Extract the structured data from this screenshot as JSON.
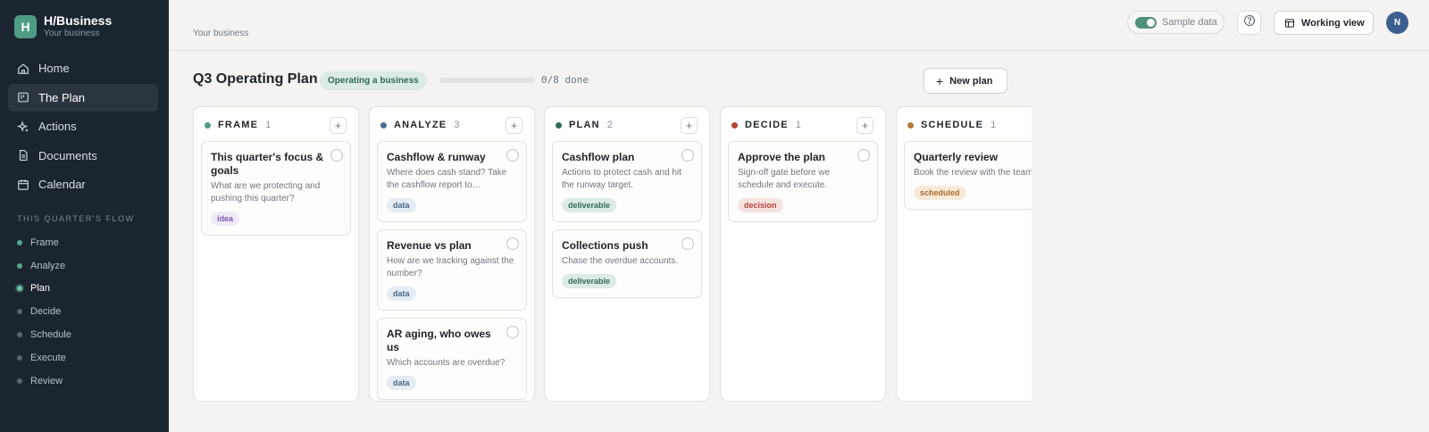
{
  "app": {
    "logo_letter": "H",
    "name": "H/Business",
    "subtitle": "Your business"
  },
  "nav": [
    {
      "label": "Home",
      "icon": "home-icon"
    },
    {
      "label": "The Plan",
      "icon": "board-icon",
      "active": true
    },
    {
      "label": "Actions",
      "icon": "sparkle-icon"
    },
    {
      "label": "Documents",
      "icon": "document-icon"
    },
    {
      "label": "Calendar",
      "icon": "calendar-icon"
    }
  ],
  "flow": {
    "title": "THIS QUARTER'S FLOW",
    "items": [
      {
        "label": "Frame",
        "state": "done"
      },
      {
        "label": "Analyze",
        "state": "done"
      },
      {
        "label": "Plan",
        "state": "current"
      },
      {
        "label": "Decide",
        "state": "todo"
      },
      {
        "label": "Schedule",
        "state": "todo"
      },
      {
        "label": "Execute",
        "state": "todo"
      },
      {
        "label": "Review",
        "state": "todo"
      }
    ]
  },
  "topbar": {
    "breadcrumb": "Your business",
    "sample_data_label": "Sample data",
    "sample_data_on": true,
    "working_view_label": "Working view",
    "avatar_initial": "N"
  },
  "plan": {
    "title": "Q3 Operating Plan",
    "mode_badge": "Operating a business",
    "progress_text": "0/8 done",
    "progress_fraction": 0,
    "new_plan_label": "New plan"
  },
  "columns": [
    {
      "name": "FRAME",
      "count": "1",
      "color": "#4f9c86",
      "cards": [
        {
          "title": "This quarter's focus & goals",
          "desc": "What are we protecting and pushing this quarter?",
          "tag": "idea"
        }
      ]
    },
    {
      "name": "ANALYZE",
      "count": "3",
      "color": "#4a6b94",
      "cards": [
        {
          "title": "Cashflow & runway",
          "desc": "Where does cash stand? Take the cashflow report to…",
          "tag": "data"
        },
        {
          "title": "Revenue vs plan",
          "desc": "How are we tracking against the number?",
          "tag": "data"
        },
        {
          "title": "AR aging, who owes us",
          "desc": "Which accounts are overdue?",
          "tag": "data"
        }
      ]
    },
    {
      "name": "PLAN",
      "count": "2",
      "color": "#2f6a58",
      "cards": [
        {
          "title": "Cashflow plan",
          "desc": "Actions to protect cash and hit the runway target.",
          "tag": "deliverable"
        },
        {
          "title": "Collections push",
          "desc": "Chase the overdue accounts.",
          "tag": "deliverable"
        }
      ]
    },
    {
      "name": "DECIDE",
      "count": "1",
      "color": "#b24438",
      "cards": [
        {
          "title": "Approve the plan",
          "desc": "Sign-off gate before we schedule and execute.",
          "tag": "decision"
        }
      ]
    },
    {
      "name": "SCHEDULE",
      "count": "1",
      "color": "#b27a3c",
      "cards": [
        {
          "title": "Quarterly review",
          "desc": "Book the review with the team.",
          "tag": "scheduled"
        }
      ]
    }
  ]
}
